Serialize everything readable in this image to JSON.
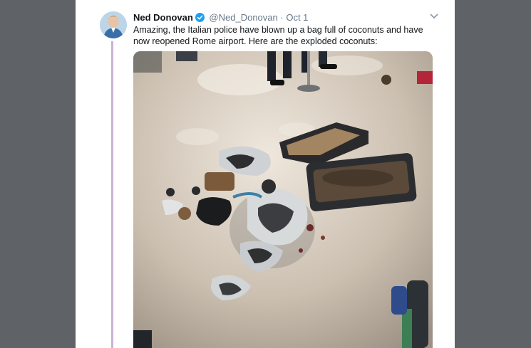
{
  "tweet": {
    "author_name": "Ned Donovan",
    "handle": "@Ned_Donovan",
    "separator": "·",
    "time": "Oct 1",
    "text": "Amazing, the Italian police have blown up a bag full of coconuts and have now reopened Rome airport. Here are the exploded coconuts:",
    "verified": true
  },
  "icons": {
    "verified": "verified-badge-icon",
    "more": "chevron-down-icon",
    "avatar": "avatar"
  },
  "colors": {
    "backdrop": "#5f6266",
    "card": "#ffffff",
    "thread_line": "#c9b3d6",
    "verified": "#1da1f2",
    "secondary_text": "#657786"
  }
}
